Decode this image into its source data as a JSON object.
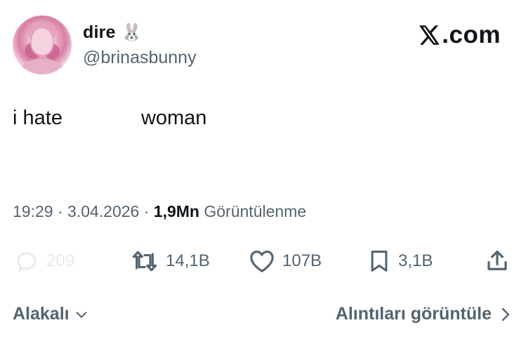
{
  "user": {
    "display_name": "dire",
    "emoji": "🐰",
    "handle": "@brinasbunny"
  },
  "brand": {
    "wordmark_suffix": ".com"
  },
  "tweet": {
    "text_part1": "i hate",
    "text_part2": "woman"
  },
  "meta": {
    "time": "19:29",
    "separator": "·",
    "date": "3.04.2026",
    "views_count": "1,9Mn",
    "views_label": "Görüntülenme"
  },
  "actions": {
    "replies": "209",
    "reposts": "14,1B",
    "likes": "107B",
    "bookmarks": "3,1B"
  },
  "footer": {
    "sort_label": "Alakalı",
    "view_quotes_label": "Alıntıları görüntüle"
  },
  "colors": {
    "text": "#0f1419",
    "secondary": "#536471",
    "faded": "#e6e9ec"
  },
  "icons": {
    "reply": "reply-icon",
    "repost": "repost-icon",
    "like": "heart-icon",
    "bookmark": "bookmark-icon",
    "share": "share-icon",
    "chevron_down": "chevron-down-icon",
    "chevron_right": "chevron-right-icon",
    "x_logo": "x-logo-icon"
  }
}
